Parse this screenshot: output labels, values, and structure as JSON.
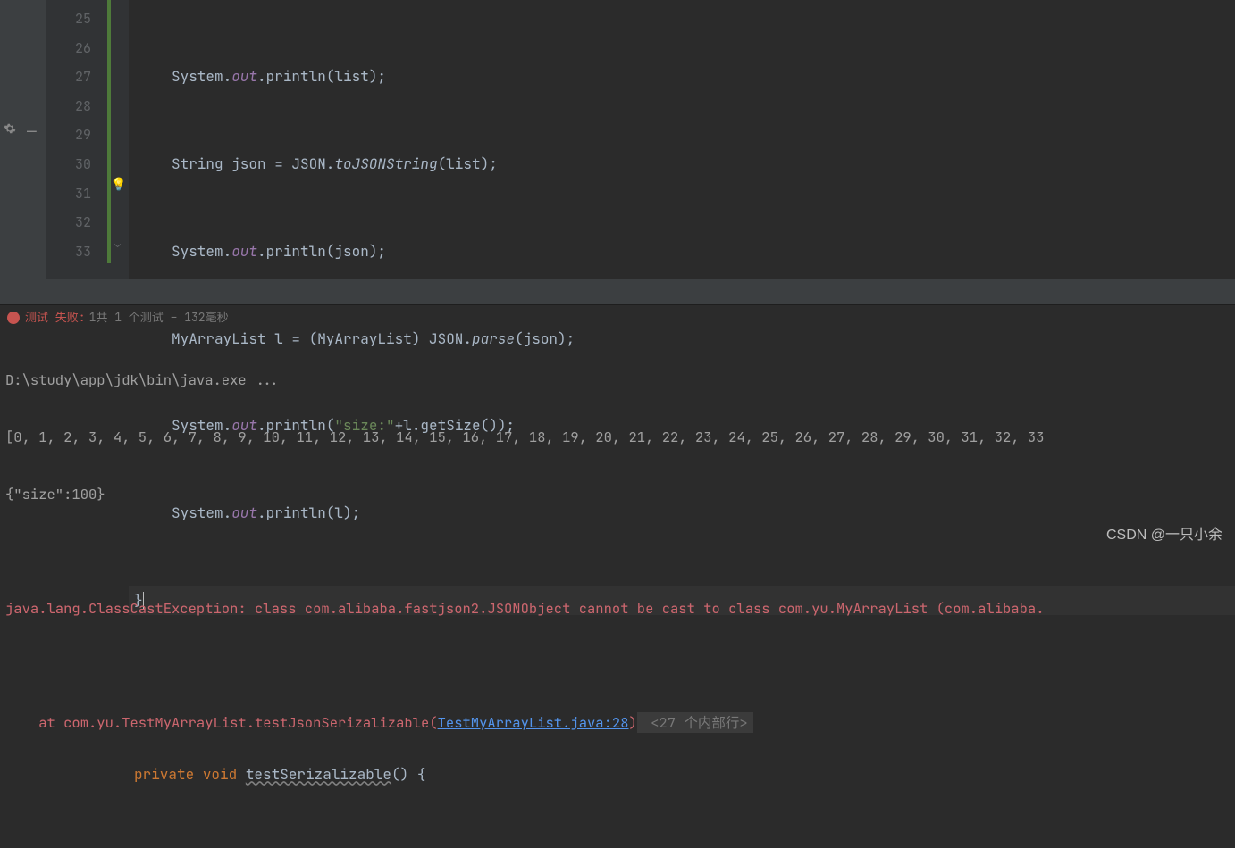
{
  "gutter": {
    "lines": [
      "25",
      "26",
      "27",
      "28",
      "29",
      "30",
      "31",
      "32",
      "33"
    ]
  },
  "code": {
    "l25": {
      "s": "System.",
      "f": "out",
      "m": ".println(list);"
    },
    "l26": {
      "a": "String json = JSON.",
      "b": "toJSONString",
      "c": "(list);"
    },
    "l27": {
      "s": "System.",
      "f": "out",
      "m": ".println(json);"
    },
    "l28": {
      "a": "MyArrayList l = (MyArrayList) JSON.",
      "b": "parse",
      "c": "(json);"
    },
    "l29": {
      "s": "System.",
      "f": "out",
      "a": ".println(",
      "str": "\"size:\"",
      "b": "+l.getSize());"
    },
    "l30": {
      "s": "System.",
      "f": "out",
      "m": ".println(l);"
    },
    "l31": {
      "brace": "}"
    },
    "l33": {
      "kw1": "private ",
      "kw2": "void ",
      "name": "testSerizalizable",
      "rest": "() {"
    }
  },
  "test": {
    "label": "测试 失败:",
    "detail": " 1共 1 个测试 – 132毫秒"
  },
  "console": {
    "c1": "D:\\study\\app\\jdk\\bin\\java.exe ...",
    "c2": "[0, 1, 2, 3, 4, 5, 6, 7, 8, 9, 10, 11, 12, 13, 14, 15, 16, 17, 18, 19, 20, 21, 22, 23, 24, 25, 26, 27, 28, 29, 30, 31, 32, 33",
    "c3": "{\"size\":100}",
    "err": "java.lang.ClassCastException: class com.alibaba.fastjson2.JSONObject cannot be cast to class com.yu.MyArrayList (com.alibaba.",
    "trace_pre": "    at com.yu.TestMyArrayList.testJsonSerizalizable(",
    "trace_link": "TestMyArrayList.java:28",
    "trace_post": ")",
    "hint": " <27 个内部行>"
  },
  "watermark": "CSDN @一只小余"
}
